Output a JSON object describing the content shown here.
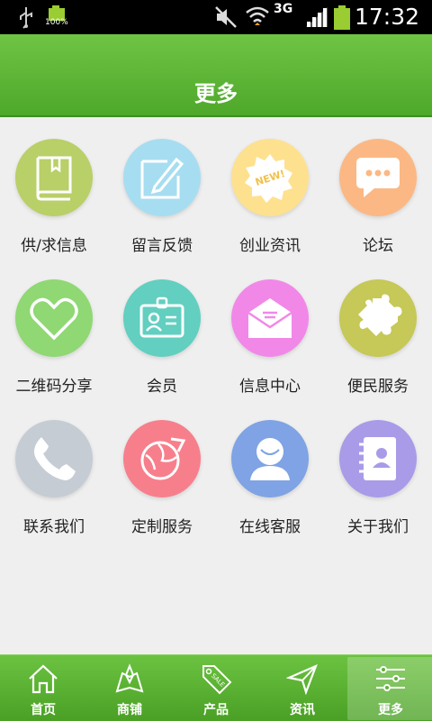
{
  "status_bar": {
    "time": "17:32",
    "battery_percent": "100%",
    "network": "3G",
    "icons": [
      "usb-icon",
      "battery-icon",
      "mute-icon",
      "wifi-icon",
      "signal-icon",
      "battery-full-icon"
    ]
  },
  "header": {
    "title": "更多"
  },
  "grid": {
    "items": [
      {
        "label": "供/求信息",
        "icon": "book-icon",
        "color": "#b9cf68"
      },
      {
        "label": "留言反馈",
        "icon": "edit-icon",
        "color": "#a7ddf1"
      },
      {
        "label": "创业资讯",
        "icon": "new-badge-icon",
        "color": "#fde18f"
      },
      {
        "label": "论坛",
        "icon": "chat-bubble-icon",
        "color": "#fbb884"
      },
      {
        "label": "二维码分享",
        "icon": "heart-icon",
        "color": "#8fd873"
      },
      {
        "label": "会员",
        "icon": "id-card-icon",
        "color": "#62cfc0"
      },
      {
        "label": "信息中心",
        "icon": "mail-icon",
        "color": "#f188e8"
      },
      {
        "label": "便民服务",
        "icon": "puzzle-icon",
        "color": "#c6c857"
      },
      {
        "label": "联系我们",
        "icon": "phone-icon",
        "color": "#c5ccd4"
      },
      {
        "label": "定制服务",
        "icon": "globe-arrow-icon",
        "color": "#f77f8c"
      },
      {
        "label": "在线客服",
        "icon": "user-icon",
        "color": "#7fa3e4"
      },
      {
        "label": "关于我们",
        "icon": "contacts-book-icon",
        "color": "#a99be8"
      }
    ]
  },
  "tabbar": {
    "tabs": [
      {
        "label": "首页",
        "icon": "home-icon",
        "active": false
      },
      {
        "label": "商铺",
        "icon": "map-pin-icon",
        "active": false
      },
      {
        "label": "产品",
        "icon": "sale-tag-icon",
        "active": false
      },
      {
        "label": "资讯",
        "icon": "send-icon",
        "active": false
      },
      {
        "label": "更多",
        "icon": "sliders-icon",
        "active": true
      }
    ]
  }
}
